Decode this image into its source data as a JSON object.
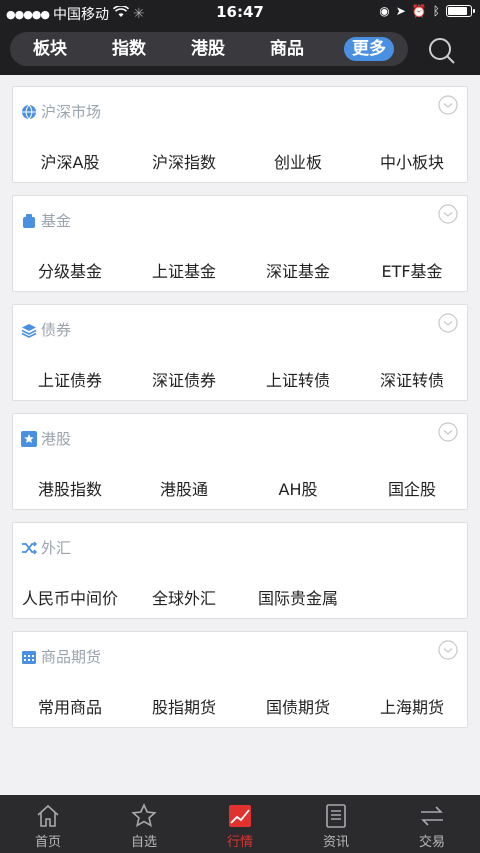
{
  "status": {
    "carrier": "中国移动",
    "time": "16:47"
  },
  "header": {
    "tabs": [
      {
        "label": "板块"
      },
      {
        "label": "指数"
      },
      {
        "label": "港股"
      },
      {
        "label": "商品"
      },
      {
        "label": "更多"
      }
    ],
    "active_tab": "更多",
    "accent": "#4a90e2"
  },
  "sections": [
    {
      "title": "沪深市场",
      "icon": "globe-icon",
      "items": [
        "沪深A股",
        "沪深指数",
        "创业板",
        "中小板块"
      ]
    },
    {
      "title": "基金",
      "icon": "fund-bag-icon",
      "items": [
        "分级基金",
        "上证基金",
        "深证基金",
        "ETF基金"
      ]
    },
    {
      "title": "债券",
      "icon": "layers-icon",
      "items": [
        "上证债券",
        "深证债券",
        "上证转债",
        "深证转债"
      ]
    },
    {
      "title": "港股",
      "icon": "bauhinia-icon",
      "items": [
        "港股指数",
        "港股通",
        "AH股",
        "国企股"
      ]
    },
    {
      "title": "外汇",
      "icon": "exchange-icon",
      "items": [
        "人民币中间价",
        "全球外汇",
        "国际贵金属"
      ]
    },
    {
      "title": "商品期货",
      "icon": "calendar-icon",
      "items": [
        "常用商品",
        "股指期货",
        "国债期货",
        "上海期货"
      ]
    }
  ],
  "tabbar": {
    "items": [
      {
        "label": "首页",
        "icon": "home-icon"
      },
      {
        "label": "自选",
        "icon": "star-icon"
      },
      {
        "label": "行情",
        "icon": "chart-icon"
      },
      {
        "label": "资讯",
        "icon": "document-icon"
      },
      {
        "label": "交易",
        "icon": "transfer-icon"
      }
    ],
    "active": "行情",
    "active_color": "#e0332f"
  }
}
